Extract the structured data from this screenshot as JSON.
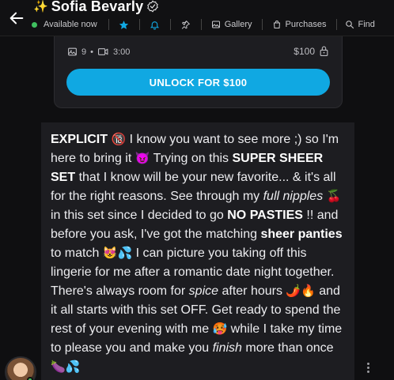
{
  "header": {
    "sparkle": "✨",
    "title": "Sofia Bevarly",
    "status": "Available now",
    "nav": {
      "gallery": "Gallery",
      "purchases": "Purchases",
      "find": "Find"
    }
  },
  "media_card": {
    "photo_count": "9",
    "dot": "•",
    "video_duration": "3:00",
    "price": "$100",
    "unlock_label": "UNLOCK FOR $100"
  },
  "message": {
    "p01": "EXPLICIT ",
    "e01": "🔞",
    "p02": " I know you want to see more ;) so I'm here to bring it ",
    "e02": "😈",
    "p03": " Trying on this ",
    "b01": "SUPER SHEER SET",
    "p04": " that I know will be your new favorite... & it's all for the right reasons. See through my ",
    "i01": "full nipples",
    "p05": " ",
    "e03": "🍒",
    "p06": " in this set since I decided to go ",
    "b02": "NO PASTIES",
    "p07": " !! and before you ask, I've got the matching ",
    "b03": "sheer panties",
    "p08": " to match ",
    "e04": "😻💦",
    "p09": " I can picture you taking off this lingerie for me after a romantic date night together. There's always room for ",
    "i02": "spice",
    "p10": " after hours ",
    "e05": "🌶️🔥",
    "p11": " and it all starts with this set OFF. Get ready to spend the rest of your evening with me ",
    "e06": "🥵",
    "p12": " while I take my time to please you and make you ",
    "i03": "finish",
    "p13": " more than once ",
    "e07": "🍆💦"
  },
  "colors": {
    "accent": "#10a8e2",
    "online": "#3fbf5f",
    "background": "#0f0f11",
    "bubble": "#1d1d21"
  },
  "icons": [
    "back-arrow-icon",
    "verified-badge-icon",
    "star-icon",
    "bell-icon",
    "pin-icon",
    "gallery-icon",
    "purchases-icon",
    "search-icon",
    "image-icon",
    "video-icon",
    "lock-icon",
    "more-options-icon"
  ]
}
